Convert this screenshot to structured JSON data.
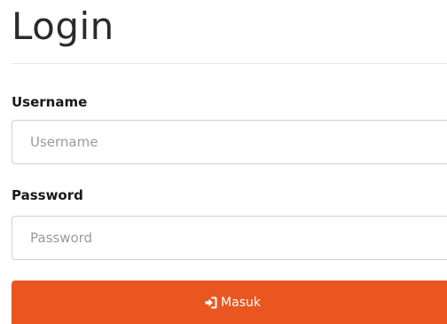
{
  "page": {
    "title": "Login"
  },
  "form": {
    "username": {
      "label": "Username",
      "placeholder": "Username",
      "value": ""
    },
    "password": {
      "label": "Password",
      "placeholder": "Password",
      "value": ""
    },
    "submit": {
      "label": "Masuk",
      "icon": "sign-in-icon",
      "color": "#e9561f"
    }
  }
}
